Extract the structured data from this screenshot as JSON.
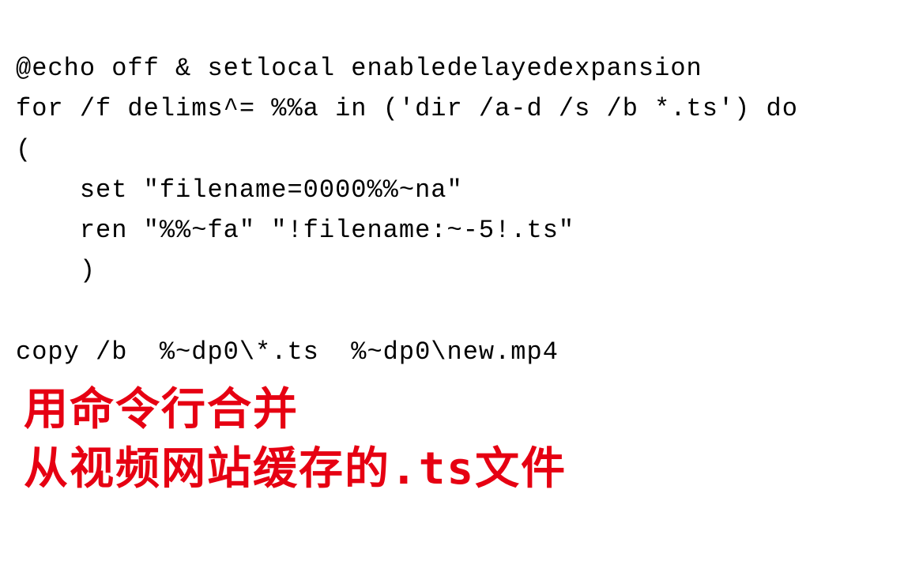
{
  "code": {
    "line1": "@echo off & setlocal enabledelayedexpansion",
    "line2": "for /f delims^= %%a in ('dir /a-d /s /b *.ts') do",
    "line3": "(",
    "line4": "    set \"filename=0000%%~na\"",
    "line5": "    ren \"%%~fa\" \"!filename:~-5!.ts\"",
    "line6": "    )",
    "line7": "",
    "line8": "copy /b  %~dp0\\*.ts  %~dp0\\new.mp4"
  },
  "caption": {
    "line1": "用命令行合并",
    "line2": "从视频网站缓存的.ts文件"
  }
}
